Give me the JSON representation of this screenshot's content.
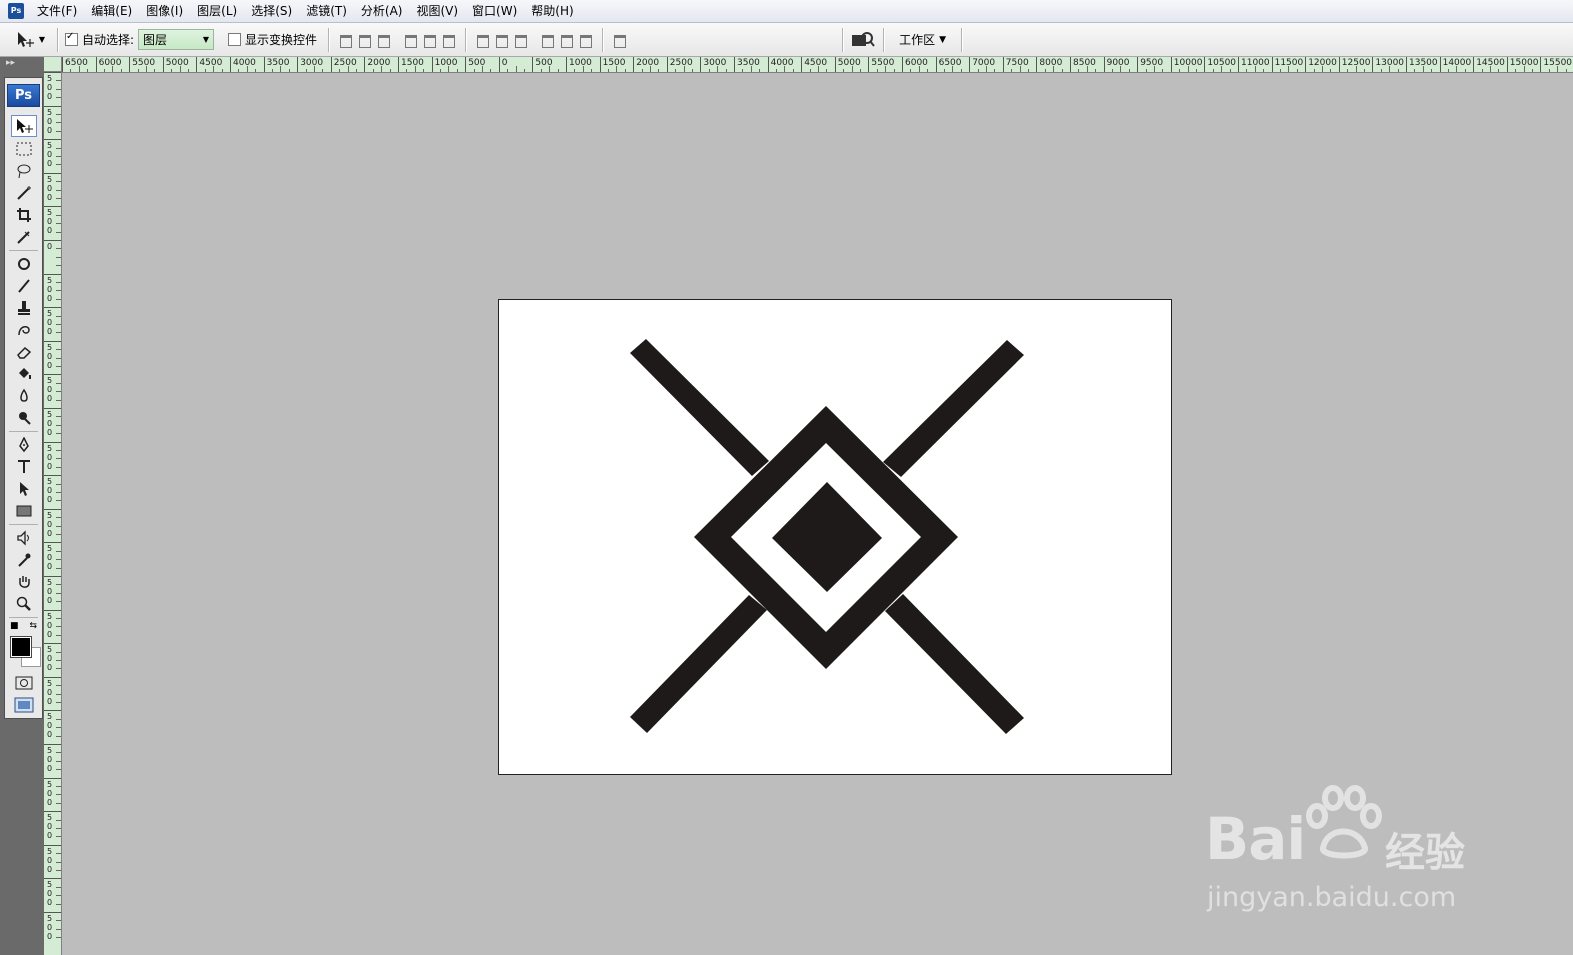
{
  "menubar": {
    "app_icon": "Ps",
    "items": [
      "文件(F)",
      "编辑(E)",
      "图像(I)",
      "图层(L)",
      "选择(S)",
      "滤镜(T)",
      "分析(A)",
      "视图(V)",
      "窗口(W)",
      "帮助(H)"
    ]
  },
  "options": {
    "auto_select_label": "自动选择:",
    "auto_select_checked": true,
    "layer_select_value": "图层",
    "show_transform_label": "显示变换控件",
    "show_transform_checked": false,
    "workspace_label": "工作区"
  },
  "toolbox": {
    "logo": "Ps",
    "tools": [
      "move-tool",
      "marquee-tool",
      "lasso-tool",
      "magic-wand-tool",
      "crop-tool",
      "slice-tool",
      "healing-brush-tool",
      "brush-tool",
      "clone-stamp-tool",
      "history-brush-tool",
      "eraser-tool",
      "paint-bucket-tool",
      "blur-tool",
      "dodge-tool",
      "pen-tool",
      "type-tool",
      "path-selection-tool",
      "shape-tool",
      "notes-tool",
      "eyedropper-tool",
      "hand-tool",
      "zoom-tool"
    ],
    "foreground_color": "#000000",
    "background_color": "#ffffff"
  },
  "ruler": {
    "h_labels": [
      "6500",
      "6000",
      "5500",
      "5000",
      "4500",
      "4000",
      "3500",
      "3000",
      "2500",
      "2000",
      "1500",
      "1000",
      "500",
      "0",
      "500",
      "1000",
      "1500",
      "2000",
      "2500",
      "3000",
      "3500",
      "4000",
      "4500",
      "5000",
      "5500",
      "6000",
      "6500",
      "7000",
      "7500",
      "8000",
      "8500",
      "9000",
      "9500",
      "10000",
      "10500",
      "11000",
      "11500",
      "12000",
      "12500",
      "13000",
      "13500",
      "14000",
      "14500",
      "15000",
      "15500"
    ],
    "v_labels": [
      "500",
      "500",
      "500",
      "500",
      "500",
      "0",
      "500",
      "500",
      "500",
      "500",
      "500",
      "500",
      "500",
      "500",
      "500",
      "500",
      "500",
      "500",
      "500",
      "500",
      "500",
      "500",
      "500",
      "500",
      "500",
      "500"
    ]
  },
  "artwork": {
    "fill": "#1e1a19",
    "background": "#ffffff"
  },
  "watermark": {
    "brand": "Bai",
    "brand_cn": "经验",
    "url": "jingyan.baidu.com"
  }
}
